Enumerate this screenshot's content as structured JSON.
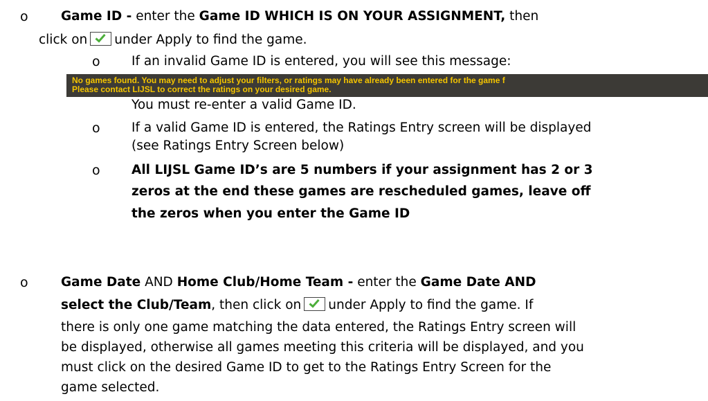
{
  "bullets": {
    "main": "o",
    "sub": "o"
  },
  "game_id_item": {
    "label": "Game ID -",
    "text1": "enter the",
    "label2": "Game ID WHICH IS ON YOUR ASSIGNMENT,",
    "text2": "then",
    "click_on": "click on",
    "after_checkbox": "under Apply to find the game.",
    "sub1": "If an invalid Game ID is entered, you will see this message:",
    "error_line1": "No games found. You may need to adjust your filters, or ratings may have already been entered for the game f",
    "error_line2": "Please contact LIJSL to correct the ratings on your desired game.",
    "reenter": "You must re-enter a valid Game ID.",
    "sub2_line1": "If a valid Game ID is entered, the Ratings Entry screen will be displayed",
    "sub2_line2": "(see Ratings Entry Screen below)",
    "sub3_line1": "All LIJSL Game ID’s are 5 numbers if your assignment has 2 or 3",
    "sub3_line2": "zeros at the end these games are rescheduled games, leave off",
    "sub3_line3": "the zeros when you enter the Game ID"
  },
  "game_date_item": {
    "label1": "Game Date",
    "and1": "AND",
    "label2": "Home Club/Home Team -",
    "text1": "enter the",
    "label3": "Game Date AND",
    "label4": "select the Club/Team",
    "text2": ", then click on",
    "after_checkbox": "under Apply to find the game. If",
    "line3": "there is only one game matching the data entered, the Ratings Entry screen will",
    "line4": "be displayed, otherwise all games meeting this criteria will be displayed, and you",
    "line5": "must click on the desired Game ID to get to the Ratings Entry Screen for the",
    "line6": "game selected."
  }
}
